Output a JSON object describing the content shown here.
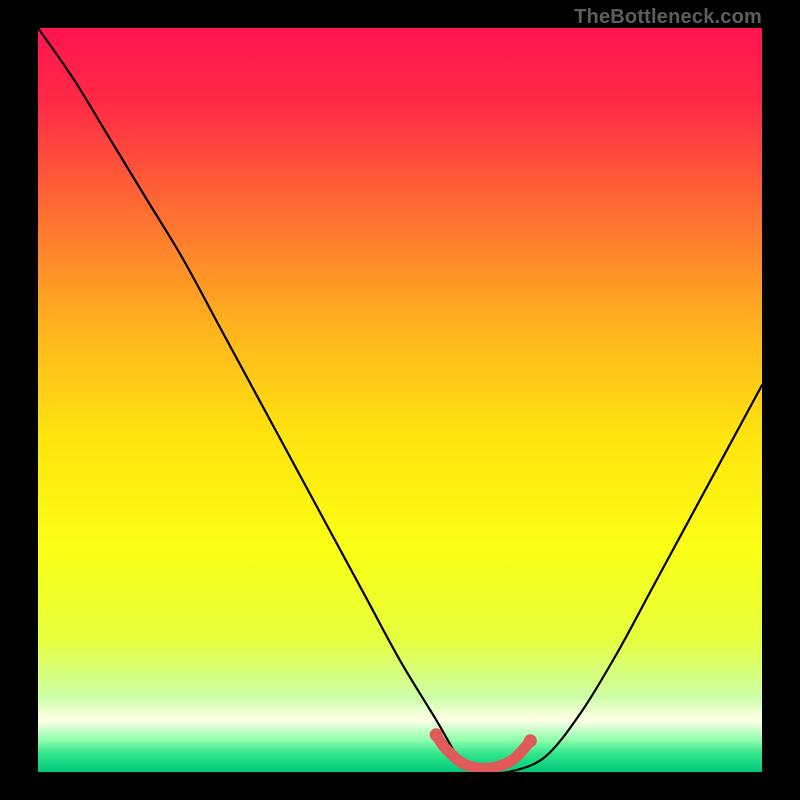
{
  "watermark": "TheBottleneck.com",
  "chart_data": {
    "type": "line",
    "title": "",
    "xlabel": "",
    "ylabel": "",
    "xlim": [
      0,
      100
    ],
    "ylim": [
      0,
      100
    ],
    "series": [
      {
        "name": "bottleneck-curve",
        "x": [
          0,
          5,
          10,
          15,
          20,
          25,
          30,
          35,
          40,
          45,
          50,
          55,
          58,
          60,
          62,
          65,
          70,
          75,
          80,
          85,
          90,
          95,
          100
        ],
        "y": [
          100,
          93,
          85,
          77,
          69,
          60,
          51,
          42,
          33,
          24,
          15,
          7,
          2,
          0,
          0,
          0,
          2,
          8,
          16,
          25,
          34,
          43,
          52
        ]
      }
    ],
    "highlight": {
      "name": "optimal-zone",
      "x": [
        55,
        56,
        57,
        58,
        59,
        60,
        61,
        62,
        63,
        64,
        65,
        66,
        67,
        68
      ],
      "y": [
        5,
        3.5,
        2.5,
        1.6,
        1,
        0.7,
        0.5,
        0.5,
        0.6,
        0.9,
        1.3,
        2,
        3,
        4.2
      ]
    },
    "gradient_stops": [
      {
        "offset": 0.0,
        "color": "#ff1450"
      },
      {
        "offset": 0.1,
        "color": "#ff2a46"
      },
      {
        "offset": 0.25,
        "color": "#ff6f32"
      },
      {
        "offset": 0.4,
        "color": "#ffb21e"
      },
      {
        "offset": 0.55,
        "color": "#ffe40e"
      },
      {
        "offset": 0.7,
        "color": "#faff14"
      },
      {
        "offset": 0.82,
        "color": "#e6ff3c"
      },
      {
        "offset": 0.9,
        "color": "#ccffaa"
      },
      {
        "offset": 0.93,
        "color": "#ffffe6"
      },
      {
        "offset": 0.955,
        "color": "#99ffb0"
      },
      {
        "offset": 0.975,
        "color": "#33e68c"
      },
      {
        "offset": 1.0,
        "color": "#00c97a"
      }
    ]
  }
}
